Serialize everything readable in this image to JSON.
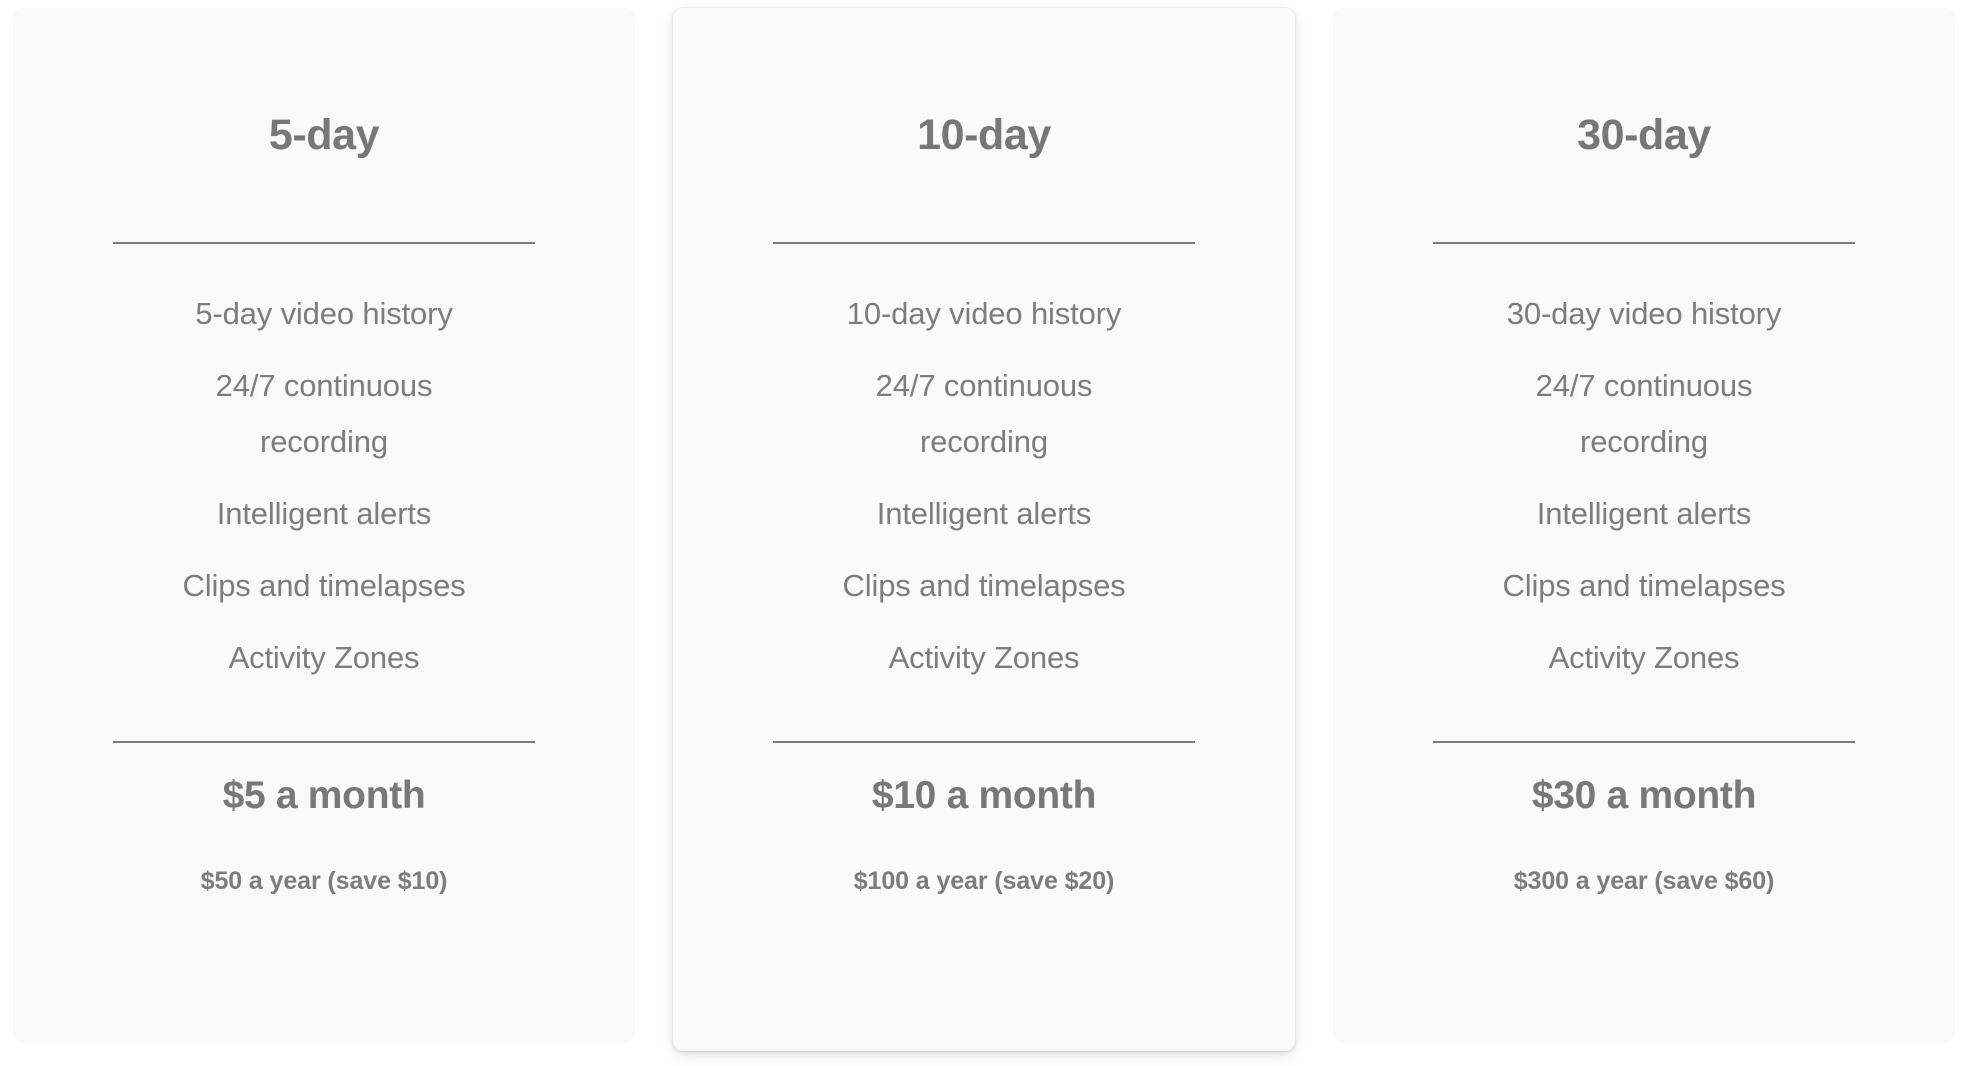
{
  "page": {
    "background_color": "#ffffff",
    "card_background_color": "#f9f9f9",
    "featured_card_background_color": "#fafafa",
    "text_color": "#7b7b7b",
    "divider_color": "#7b7b7b"
  },
  "plans": [
    {
      "id": "plan-5-day",
      "title": "5-day",
      "featured": false,
      "features": [
        "5-day video history",
        "24/7 continuous recording",
        "Intelligent alerts",
        "Clips and timelapses",
        "Activity Zones"
      ],
      "price_monthly": "$5 a month",
      "price_yearly": "$50 a year (save $10)"
    },
    {
      "id": "plan-10-day",
      "title": "10-day",
      "featured": true,
      "features": [
        "10-day video history",
        "24/7 continuous recording",
        "Intelligent alerts",
        "Clips and timelapses",
        "Activity Zones"
      ],
      "price_monthly": "$10 a month",
      "price_yearly": "$100 a year (save $20)"
    },
    {
      "id": "plan-30-day",
      "title": "30-day",
      "featured": false,
      "features": [
        "30-day video history",
        "24/7 continuous recording",
        "Intelligent alerts",
        "Clips and timelapses",
        "Activity Zones"
      ],
      "price_monthly": "$30 a month",
      "price_yearly": "$300 a year (save $60)"
    }
  ]
}
